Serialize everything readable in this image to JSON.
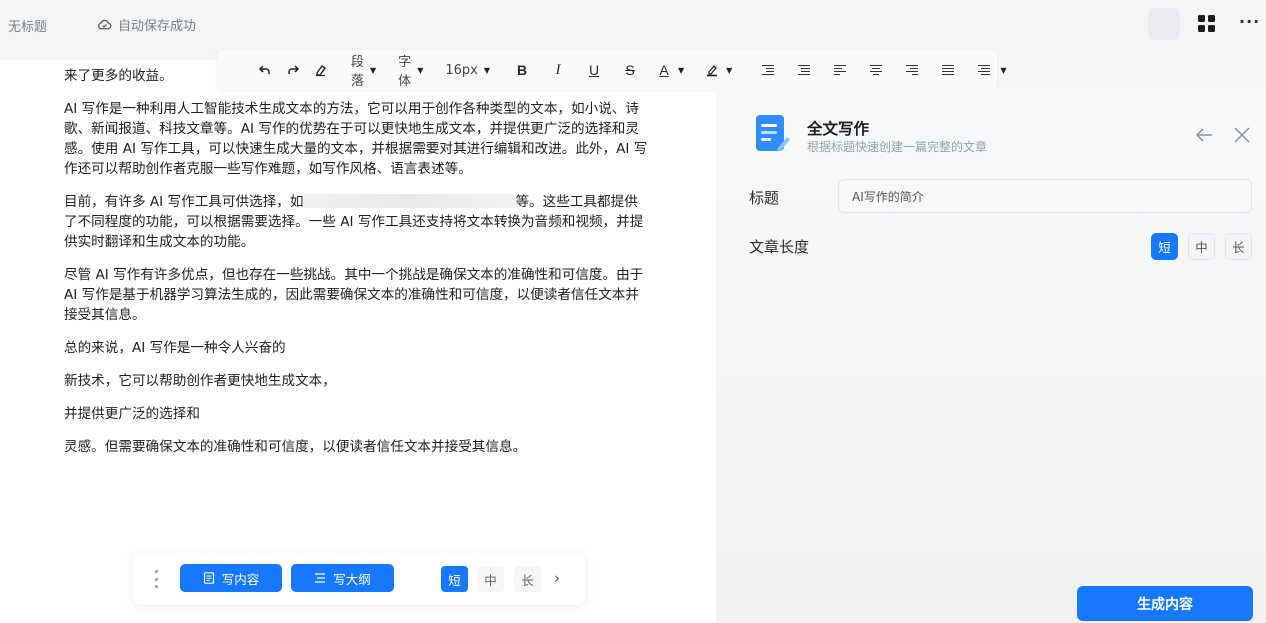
{
  "header": {
    "doc_title": "无标题",
    "autosave_status": "自动保存成功",
    "more_label": "···"
  },
  "toolbar": {
    "paragraph_label": "段落",
    "font_label": "字体",
    "font_size": "16px",
    "bold_label": "B",
    "italic_label": "I",
    "underline_label": "U",
    "strike_label": "S",
    "font_color_label": "A"
  },
  "editor": {
    "paragraphs": [
      "来了更多的收益。",
      "AI 写作是一种利用人工智能技术生成文本的方法，它可以用于创作各种类型的文本，如小说、诗歌、新闻报道、科技文章等。AI 写作的优势在于可以更快地生成文本，并提供更广泛的选择和灵感。使用 AI 写作工具，可以快速生成大量的文本，并根据需要对其进行编辑和改进。此外，AI 写作还可以帮助创作者克服一些写作难题，如写作风格、语言表述等。",
      "等。这些工具都提供了不同程度的功能，可以根据需要选择。一些 AI 写作工具还支持将文本转换为音频和视频，并提供实时翻译和生成文本的功能。",
      "尽管 AI 写作有许多优点，但也存在一些挑战。其中一个挑战是确保文本的准确性和可信度。由于 AI 写作是基于机器学习算法生成的，因此需要确保文本的准确性和可信度，以便读者信任文本并接受其信息。",
      "总的来说，AI 写作是一种令人兴奋的",
      "新技术，它可以帮助创作者更快地生成文本，",
      "并提供更广泛的选择和",
      "灵感。但需要确保文本的准确性和可信度，以便读者信任文本并接受其信息。"
    ],
    "para3_prefix": "目前，有许多 AI 写作工具可供选择，如"
  },
  "aibar": {
    "write_content_label": "写内容",
    "write_outline_label": "写大纲",
    "len_short": "短",
    "len_mid": "中",
    "len_long": "长",
    "next_label": "›"
  },
  "panel": {
    "title": "全文写作",
    "subtitle": "根据标题快速创建一篇完整的文章",
    "title_field_label": "标题",
    "title_field_value": "AI写作的简介",
    "length_label": "文章长度",
    "len_short": "短",
    "len_mid": "中",
    "len_long": "长",
    "generate_label": "生成内容"
  },
  "colors": {
    "accent": "#1677ff",
    "page_bg": "#f4f5f7",
    "panel_bg": "#f7f8fa"
  },
  "icons": [
    "cloud-check-icon",
    "apps-grid-icon",
    "more-icon",
    "undo-icon",
    "redo-icon",
    "clear-format-icon",
    "highlight-icon",
    "align-icon",
    "document-icon",
    "list-icon",
    "back-arrow-icon",
    "close-icon"
  ]
}
